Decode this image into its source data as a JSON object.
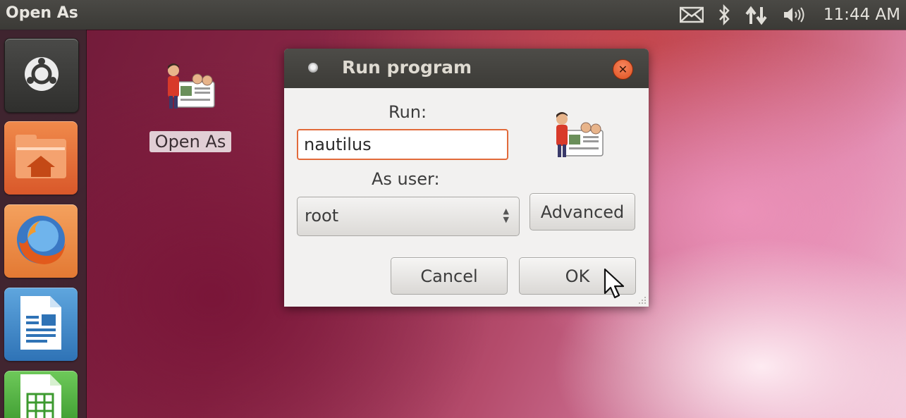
{
  "top_panel": {
    "app_title": "Open As",
    "clock": "11:44 AM",
    "indicators": [
      "mail-icon",
      "bluetooth-icon",
      "network-icon",
      "volume-icon"
    ]
  },
  "launcher": {
    "items": [
      {
        "name": "dash-icon"
      },
      {
        "name": "home-folder-icon"
      },
      {
        "name": "firefox-icon"
      },
      {
        "name": "libreoffice-writer-icon"
      },
      {
        "name": "libreoffice-calc-icon"
      }
    ]
  },
  "desktop": {
    "icon_label": "Open As"
  },
  "dialog": {
    "title": "Run program",
    "run_label": "Run:",
    "run_value": "nautilus",
    "user_label": "As user:",
    "user_value": "root",
    "advanced_label": "Advanced",
    "cancel_label": "Cancel",
    "ok_label": "OK"
  },
  "colors": {
    "accent_orange": "#e26a3a",
    "panel_bg": "#3c3b37",
    "dialog_bg": "#f2f1f0"
  }
}
